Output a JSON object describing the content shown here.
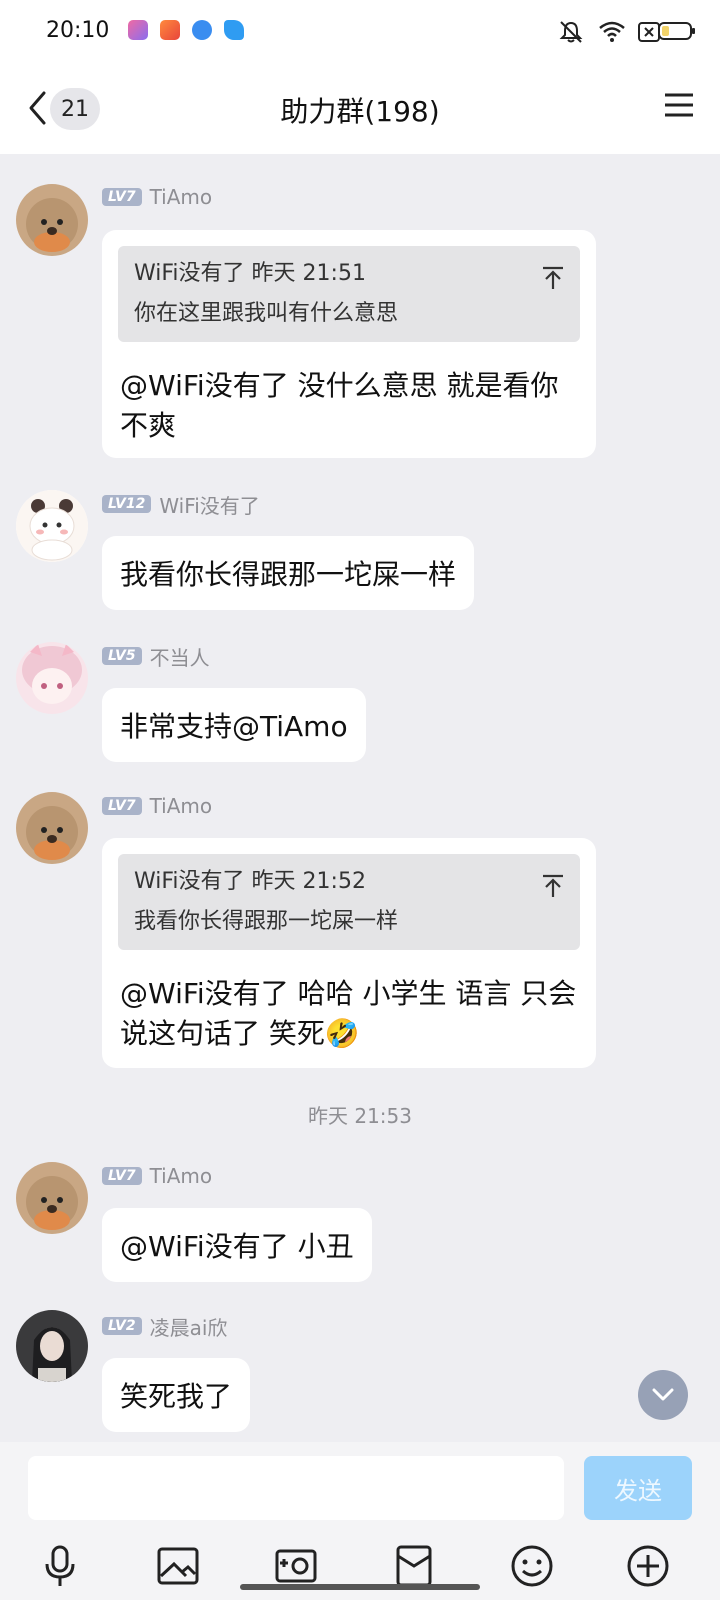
{
  "status_bar": {
    "time": "20:10",
    "app_colors": [
      "#a86de0",
      "#f06a4b",
      "#3a8df0",
      "#2f9cf2"
    ]
  },
  "header": {
    "back_count": "21",
    "title": "助力群(198)"
  },
  "messages": [
    {
      "level": "LV7",
      "name": "TiAmo",
      "quote_head": "WiFi没有了  昨天 21:51",
      "quote_text": "你在这里跟我叫有什么意思",
      "text": "@WiFi没有了 没什么意思 就是看你不爽"
    },
    {
      "level": "LV12",
      "name": "WiFi没有了",
      "text": "我看你长得跟那一坨屎一样"
    },
    {
      "level": "LV5",
      "name": "不当人",
      "text": "非常支持@TiAmo"
    },
    {
      "level": "LV7",
      "name": "TiAmo",
      "quote_head": "WiFi没有了  昨天 21:52",
      "quote_text": "我看你长得跟那一坨屎一样",
      "text": "@WiFi没有了 哈哈 小学生 语言 只会说这句话了 笑死🤣"
    },
    {
      "timestamp": "昨天 21:53"
    },
    {
      "level": "LV7",
      "name": "TiAmo",
      "text": "@WiFi没有了 小丑"
    },
    {
      "level": "LV2",
      "name": "凌晨ai欣",
      "text": "笑死我了"
    }
  ],
  "composer": {
    "value": "",
    "send_label": "发送"
  },
  "toolbar_icons": [
    "microphone-icon",
    "image-icon",
    "camera-icon",
    "red-packet-icon",
    "emoji-icon",
    "plus-icon"
  ],
  "colors": {
    "background": "#eeeef2",
    "send_button": "#9cd3fb",
    "level_badge": "#a9b3c9"
  }
}
